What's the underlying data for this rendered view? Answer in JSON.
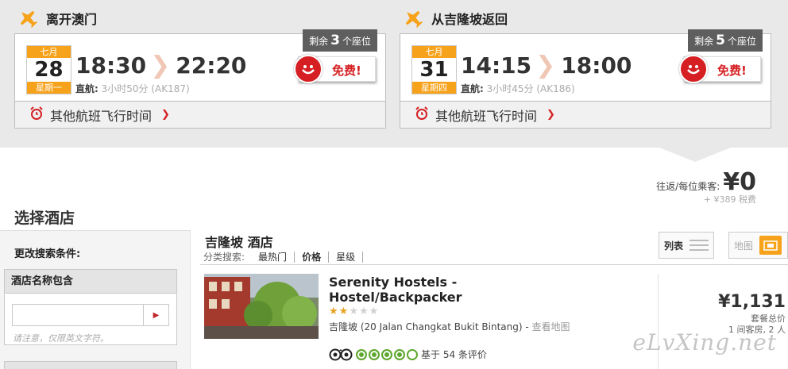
{
  "outbound": {
    "title": "离开澳门",
    "seats": {
      "prefix": "剩余",
      "count": "3",
      "suffix": "个座位"
    },
    "month": "七月",
    "day": "28",
    "weekday": "星期一",
    "depart": "18:30",
    "arrive": "22:20",
    "direct_label": "直航:",
    "duration": "3小时50分 (AK187)",
    "free_label": "免费!",
    "other_times": "其他航班飞行时间"
  },
  "return": {
    "title": "从吉隆坡返回",
    "seats": {
      "prefix": "剩余",
      "count": "5",
      "suffix": "个座位"
    },
    "month": "七月",
    "day": "31",
    "weekday": "星期四",
    "depart": "14:15",
    "arrive": "18:00",
    "direct_label": "直航:",
    "duration": "3小时45分 (AK186)",
    "free_label": "免费!",
    "other_times": "其他航班飞行时间"
  },
  "fare": {
    "label": "往返/每位乘客:",
    "amount": "¥0",
    "tax": "+ ¥389 税费"
  },
  "page_title": "选择酒店",
  "sidebar": {
    "heading": "更改搜索条件:",
    "name_filter": {
      "header": "酒店名称包含",
      "value": "",
      "hint": "请注意，仅限英文字符。"
    }
  },
  "results": {
    "title": "吉隆坡 酒店",
    "sort_label": "分类搜索:",
    "sort_options": [
      "最热门",
      "价格",
      "星级"
    ],
    "view_list": "列表",
    "view_map": "地图"
  },
  "hotel": {
    "name": "Serenity Hostels - Hostel/Backpacker",
    "stars": 2,
    "max_stars": 5,
    "address": "吉隆坡 (20 Jalan Changkat Bukit Bintang) - ",
    "map_link": "查看地图",
    "rating_dots": 4,
    "reviews": "基于 54 条评价",
    "price": "¥1,131",
    "price_note": "套餐总价",
    "guests": "1 间客房, 2 人"
  },
  "watermark": "eLvXing.net",
  "colors": {
    "accent_orange": "#f7a21b",
    "free_red": "#d51f22",
    "tripadvisor_green": "#5fa82f"
  }
}
